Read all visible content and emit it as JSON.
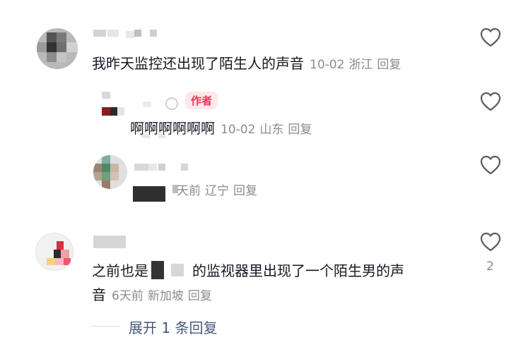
{
  "comments": [
    {
      "text": "我昨天监控还出现了陌生人的声音",
      "date": "10-02",
      "location": "浙江",
      "reply_label": "回复"
    },
    {
      "badge": "作者",
      "text": "啊啊啊啊啊啊",
      "date": "10-02",
      "location": "山东",
      "reply_label": "回复"
    },
    {
      "date": "天前",
      "location": "辽宁",
      "reply_label": "回复"
    },
    {
      "text_part1": "之前也是",
      "text_part2": "的监视器里出现了一个陌生男的声",
      "text_line2": "音",
      "date": "6天前",
      "location": "新加坡",
      "reply_label": "回复",
      "likes": "2"
    }
  ],
  "expand_label": "展开 1 条回复",
  "colors": {
    "text": "#161823",
    "meta": "#8a8b91",
    "badge_bg": "#fde8ea",
    "badge_text": "#fe2c55",
    "link": "#46587a"
  },
  "icons": [
    "heart-outline-icon"
  ]
}
